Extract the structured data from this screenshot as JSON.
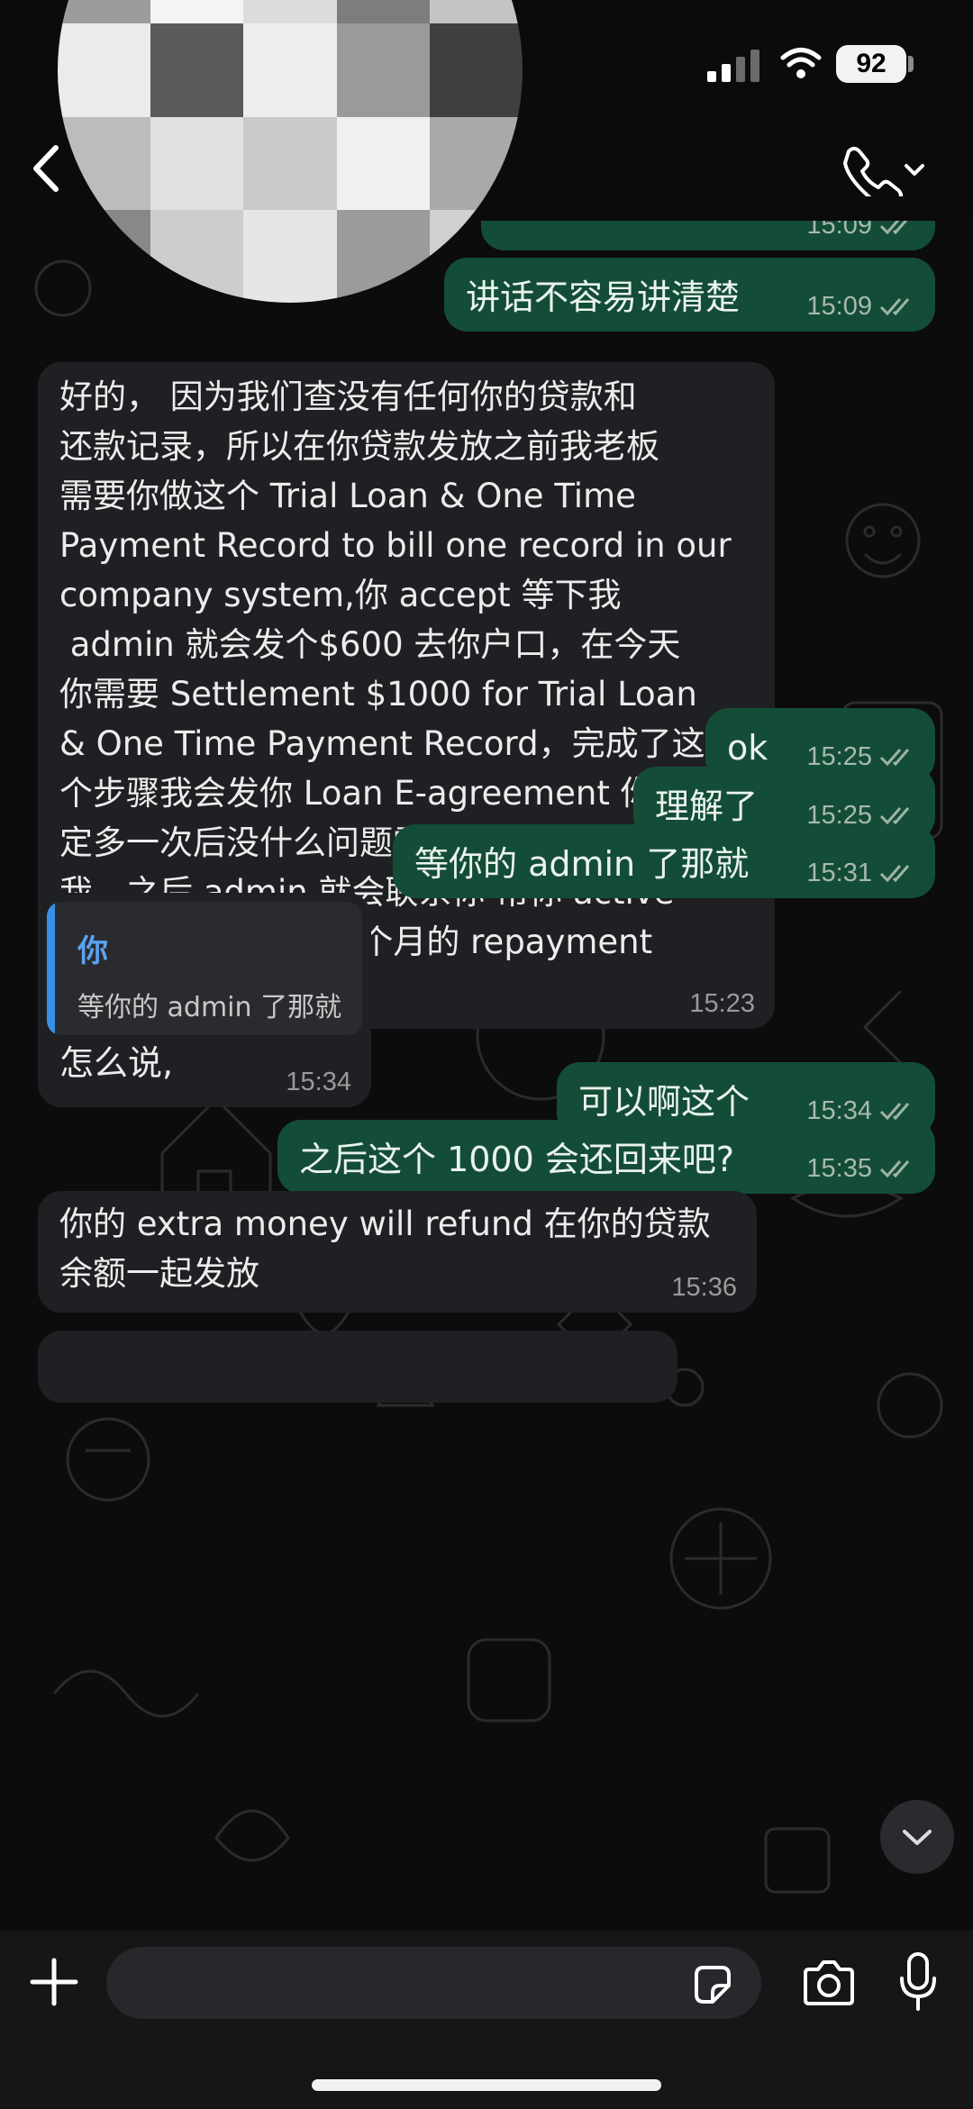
{
  "status_bar": {
    "battery": "92"
  },
  "header": {
    "avatar_pixels": [
      "#cfcfcf",
      "#8f8f8f",
      "#b8b8b8",
      "#5e5e5e",
      "#d9d9d9",
      "#9c9c9c",
      "#f4f4f4",
      "#dcdcdc",
      "#7d7d7d",
      "#c4c4c4",
      "#ebebeb",
      "#5a5a5a",
      "#eeeeee",
      "#9a9a9a",
      "#3f3f3f",
      "#bcbcbc",
      "#e1e1e1",
      "#c9c9c9",
      "#f0f0f0",
      "#a9a9a9",
      "#888888",
      "#cdcdcd",
      "#e6e6e6",
      "#9b9b9b",
      "#d0d0d0"
    ]
  },
  "messages": [
    {
      "id": "m0",
      "dir": "out",
      "text": "",
      "time": "15:09"
    },
    {
      "id": "m1",
      "dir": "out",
      "text": "讲话不容易讲清楚",
      "time": "15:09"
    },
    {
      "id": "m2",
      "dir": "in",
      "text": "好的， 因为我们查没有任何你的贷款和\n还款记录，所以在你贷款发放之前我老板\n需要你做这个 Trial Loan & One Time\nPayment Record to bill one record in our\ncompany system,你 accept 等下我\n admin 就会发个$600 去你户口，在今天\n你需要 Settlement $1000 for Trial Loan\n& One Time Payment Record，完成了这\n个步骤我会发你 Loan E-agreement 你确\n定多一次后没什么问题需要签名了发回给\n我，之后 admin 就会联系你 帮你 active\n一个账户是 for 你每个月的 repayment\naccount",
      "time": "15:23"
    },
    {
      "id": "m3",
      "dir": "out",
      "text": "ok",
      "time": "15:25"
    },
    {
      "id": "m4",
      "dir": "out",
      "text": "理解了",
      "time": "15:25"
    },
    {
      "id": "m5",
      "dir": "out",
      "text": "等你的 admin 了那就",
      "time": "15:31"
    },
    {
      "id": "m6",
      "dir": "in",
      "text": "怎么说,",
      "time": "15:34",
      "quote": {
        "author": "你",
        "text": "等你的 admin 了那就"
      }
    },
    {
      "id": "m7",
      "dir": "out",
      "text": "可以啊这个",
      "time": "15:34"
    },
    {
      "id": "m8",
      "dir": "out",
      "text": "之后这个 1000 会还回来吧?",
      "time": "15:35"
    },
    {
      "id": "m9",
      "dir": "in",
      "text": "你的 extra money will refund 在你的贷款\n余额一起发放",
      "time": "15:36"
    }
  ],
  "composer": {
    "placeholder": ""
  },
  "icons": {
    "back": "chevron-left-icon",
    "call": "phone-icon",
    "plus": "plus-icon",
    "sticker": "sticker-icon",
    "camera": "camera-icon",
    "mic": "microphone-icon",
    "scroll": "chevron-down-icon",
    "read": "double-check-icon"
  },
  "colors": {
    "outgoing_bubble": "#144d37",
    "incoming_bubble": "#1f2023",
    "quote_accent": "#3a8fe8",
    "read_ticks": "#9fb3a9"
  }
}
